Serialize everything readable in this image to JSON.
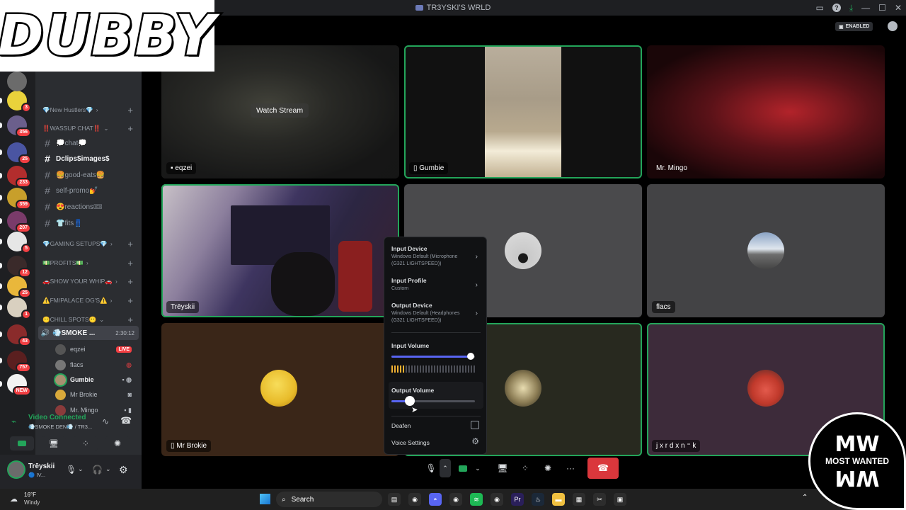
{
  "window": {
    "title": "TR3YSKI'S WRLD",
    "enabled_badge": "ENABLED"
  },
  "overlay": {
    "logo_text": "DUBBY",
    "watermark_text": "MOST WANTED"
  },
  "servers": [
    {
      "badge": "3",
      "color": "#e9d23b"
    },
    {
      "badge": "356",
      "color": "#6b5f8c"
    },
    {
      "badge": "25",
      "color": "#4a55a2"
    },
    {
      "badge": "233",
      "color": "#b32d2d"
    },
    {
      "badge": "359",
      "color": "#c89f2b"
    },
    {
      "badge": "207",
      "color": "#7a3b6a"
    },
    {
      "badge": "5",
      "color": "#e6e6e6"
    },
    {
      "badge": "12",
      "color": "#3a2a2a"
    },
    {
      "badge": "25",
      "color": "#e9b73b"
    },
    {
      "badge": "1",
      "color": "#d9d0c0"
    },
    {
      "badge": "43",
      "color": "#8a2b2b"
    },
    {
      "badge": "757",
      "color": "#5a1f1f"
    },
    {
      "badge": "NEW",
      "color": "#f2f2f2"
    }
  ],
  "channels": {
    "categories": [
      {
        "label": "💎New Hustlers💎"
      },
      {
        "label": "‼️WASSUP CHAT‼️"
      },
      {
        "label": "💎GAMING SETUPS💎"
      },
      {
        "label": "💵PROFITS💵"
      },
      {
        "label": "🚗SHOW YOUR WHIP🚗"
      },
      {
        "label": "⚠️FM/PALACE OG'S⚠️"
      },
      {
        "label": "😶CHILL SPOTS😶"
      }
    ],
    "text_channels": [
      {
        "label": "💭chat💭"
      },
      {
        "label": "Dclips$images$"
      },
      {
        "label": "🍔good-eats🍔"
      },
      {
        "label": "self-promo💅"
      },
      {
        "label": "😍reactions🎟"
      },
      {
        "label": "👕fits👖"
      }
    ],
    "voice_channel": {
      "label": "💨SMOKE ...",
      "timer": "2:30:12"
    },
    "voice_users": [
      {
        "name": "eqzei",
        "live": "LIVE"
      },
      {
        "name": "flacs"
      },
      {
        "name": "Gumbie"
      },
      {
        "name": "Mr Brokie"
      },
      {
        "name": "Mr. Mingo"
      }
    ]
  },
  "voice_status": {
    "title": "Video Connected",
    "channel": "💨SMOKE DEN💨 / TR3..."
  },
  "user": {
    "name": "Trēyskii",
    "status": "🔵 IV..."
  },
  "tiles": [
    {
      "name": "eqzei",
      "overlay": "Watch Stream"
    },
    {
      "name": "Gumbie"
    },
    {
      "name": "Mr. Mingo"
    },
    {
      "name": "Trēyskii"
    },
    {
      "name": ""
    },
    {
      "name": "flacs"
    },
    {
      "name": "Mr Brokie"
    },
    {
      "name": ""
    },
    {
      "name": "j x r d x n ⁼ k"
    }
  ],
  "popup": {
    "input_device": {
      "label": "Input Device",
      "value": "Windows Default (Microphone (G321 LIGHTSPEED))"
    },
    "input_profile": {
      "label": "Input Profile",
      "value": "Custom"
    },
    "output_device": {
      "label": "Output Device",
      "value": "Windows Default (Headphones (G321 LIGHTSPEED))"
    },
    "input_volume": {
      "label": "Input Volume",
      "level": 0.95
    },
    "output_volume": {
      "label": "Output Volume",
      "level": 0.22
    },
    "deafen": "Deafen",
    "voice_settings": "Voice Settings"
  },
  "taskbar": {
    "temp": "16°F",
    "weather": "Windy",
    "search": "Search"
  },
  "colors": {
    "accent": "#5865f2",
    "green": "#23a55a",
    "red": "#da373c"
  }
}
